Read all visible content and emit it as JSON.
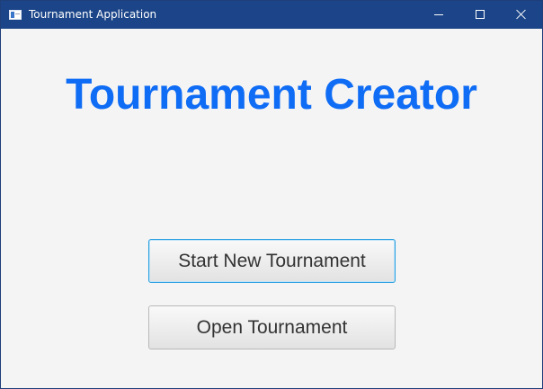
{
  "window": {
    "title": "Tournament Application",
    "icons": {
      "app": "app-window-icon",
      "minimize": "minimize-icon",
      "maximize": "maximize-icon",
      "close": "close-icon"
    }
  },
  "main": {
    "heading": "Tournament Creator",
    "start_button_label": "Start New Tournament",
    "open_button_label": "Open Tournament"
  },
  "colors": {
    "titlebar": "#1b4588",
    "heading": "#0f6cf5",
    "background": "#f4f4f4",
    "focus_border": "#2a9fe0"
  }
}
